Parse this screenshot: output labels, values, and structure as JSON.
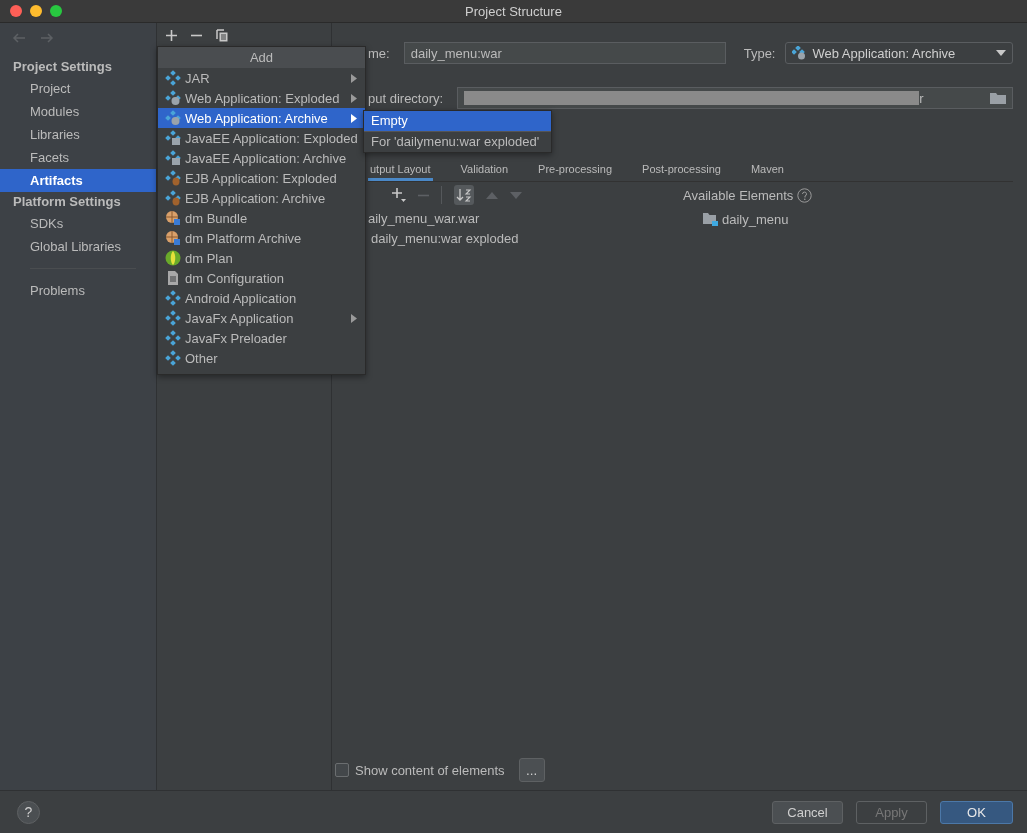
{
  "window": {
    "title": "Project Structure"
  },
  "sidebar": {
    "sections": [
      {
        "title": "Project Settings",
        "items": [
          {
            "label": "Project",
            "selected": false
          },
          {
            "label": "Modules",
            "selected": false
          },
          {
            "label": "Libraries",
            "selected": false
          },
          {
            "label": "Facets",
            "selected": false
          },
          {
            "label": "Artifacts",
            "selected": true
          }
        ]
      },
      {
        "title": "Platform Settings",
        "items": [
          {
            "label": "SDKs",
            "selected": false
          },
          {
            "label": "Global Libraries",
            "selected": false
          }
        ]
      }
    ],
    "bottom_items": [
      {
        "label": "Problems",
        "selected": false
      }
    ]
  },
  "add_menu": {
    "title": "Add",
    "items": [
      {
        "label": "JAR",
        "kind": "diamond",
        "submenu": true,
        "selected": false
      },
      {
        "label": "Web Application: Exploded",
        "kind": "web",
        "submenu": true,
        "selected": false
      },
      {
        "label": "Web Application: Archive",
        "kind": "web",
        "submenu": true,
        "selected": true
      },
      {
        "label": "JavaEE Application: Exploded",
        "kind": "javaee",
        "submenu": false,
        "selected": false
      },
      {
        "label": "JavaEE Application: Archive",
        "kind": "javaee",
        "submenu": false,
        "selected": false
      },
      {
        "label": "EJB Application: Exploded",
        "kind": "ejb",
        "submenu": false,
        "selected": false
      },
      {
        "label": "EJB Application: Archive",
        "kind": "ejb",
        "submenu": false,
        "selected": false
      },
      {
        "label": "dm Bundle",
        "kind": "bundle",
        "submenu": false,
        "selected": false
      },
      {
        "label": "dm Platform Archive",
        "kind": "bundle",
        "submenu": false,
        "selected": false
      },
      {
        "label": "dm Plan",
        "kind": "plan",
        "submenu": false,
        "selected": false
      },
      {
        "label": "dm Configuration",
        "kind": "file",
        "submenu": false,
        "selected": false
      },
      {
        "label": "Android Application",
        "kind": "diamond",
        "submenu": false,
        "selected": false
      },
      {
        "label": "JavaFx Application",
        "kind": "diamond",
        "submenu": true,
        "selected": false
      },
      {
        "label": "JavaFx Preloader",
        "kind": "diamond",
        "submenu": false,
        "selected": false
      },
      {
        "label": "Other",
        "kind": "diamond",
        "submenu": false,
        "selected": false
      }
    ]
  },
  "submenu": {
    "items": [
      {
        "label": "Empty",
        "selected": true
      },
      {
        "label": "For 'dailymenu:war exploded'",
        "selected": false
      }
    ]
  },
  "artifact": {
    "name_label": "me:",
    "name_value": "daily_menu:war",
    "type_label": "Type:",
    "type_value": "Web Application: Archive",
    "output_label": "put directory:",
    "output_value_visible": "r"
  },
  "tabs": [
    {
      "label": "utput Layout",
      "selected": true
    },
    {
      "label": "Validation",
      "selected": false
    },
    {
      "label": "Pre-processing",
      "selected": false
    },
    {
      "label": "Post-processing",
      "selected": false
    },
    {
      "label": "Maven",
      "selected": false
    }
  ],
  "layout_tree": [
    "aily_menu_war.war",
    "daily_menu:war exploded"
  ],
  "available": {
    "title": "Available Elements",
    "items": [
      "daily_menu"
    ]
  },
  "show_content": {
    "label": "Show content of elements",
    "checked": false,
    "more": "..."
  },
  "footer": {
    "help": "?",
    "buttons": [
      {
        "label": "Cancel",
        "kind": "normal"
      },
      {
        "label": "Apply",
        "kind": "disabled"
      },
      {
        "label": "OK",
        "kind": "primary"
      }
    ]
  }
}
